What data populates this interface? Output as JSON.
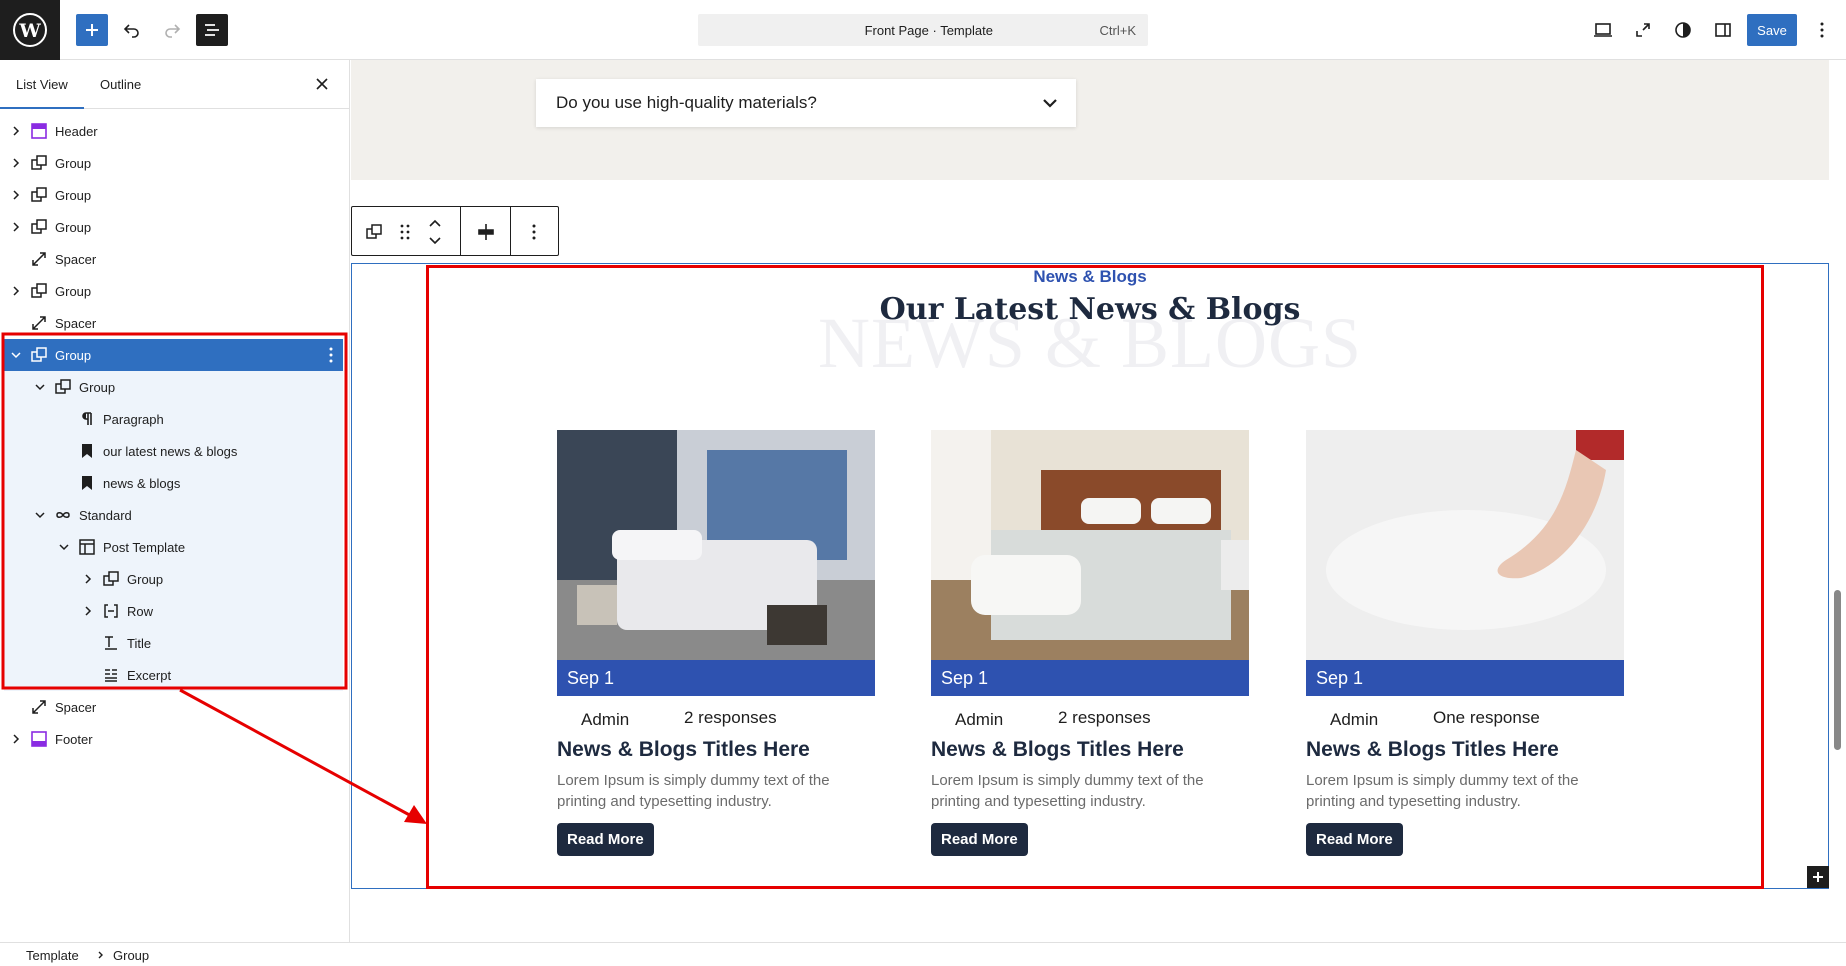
{
  "topbar": {
    "command_title": "Front Page · Template",
    "command_shortcut": "Ctrl+K",
    "save_label": "Save"
  },
  "panel": {
    "tabs": [
      "List View",
      "Outline"
    ],
    "tree": [
      {
        "label": "Header",
        "icon": "header-icon"
      },
      {
        "label": "Group",
        "icon": "group-icon"
      },
      {
        "label": "Group",
        "icon": "group-icon"
      },
      {
        "label": "Group",
        "icon": "group-icon"
      },
      {
        "label": "Spacer",
        "icon": "spacer-icon"
      },
      {
        "label": "Group",
        "icon": "group-icon"
      },
      {
        "label": "Spacer",
        "icon": "spacer-icon"
      },
      {
        "label": "Group",
        "icon": "group-icon",
        "selected": true
      },
      {
        "label": "Group",
        "icon": "group-icon"
      },
      {
        "label": "Paragraph",
        "icon": "paragraph-icon"
      },
      {
        "label": "our latest news & blogs",
        "icon": "bookmark-icon"
      },
      {
        "label": "news & blogs",
        "icon": "bookmark-icon"
      },
      {
        "label": "Standard",
        "icon": "loop-icon"
      },
      {
        "label": "Post Template",
        "icon": "layout-icon"
      },
      {
        "label": "Group",
        "icon": "group-icon"
      },
      {
        "label": "Row",
        "icon": "row-icon"
      },
      {
        "label": "Title",
        "icon": "title-icon"
      },
      {
        "label": "Excerpt",
        "icon": "excerpt-icon"
      },
      {
        "label": "Spacer",
        "icon": "spacer-icon"
      },
      {
        "label": "Footer",
        "icon": "footer-icon"
      }
    ]
  },
  "canvas": {
    "faq_question": "Do you use high-quality materials?",
    "eyebrow": "News & Blogs",
    "heading": "Our Latest News & Blogs",
    "ghost_text": "NEWS & BLOGS",
    "cards": [
      {
        "date": "Sep 1",
        "author": "Admin",
        "responses": "2 responses",
        "title": "News & Blogs Titles Here",
        "excerpt": "Lorem Ipsum is simply dummy text of the printing and typesetting industry.",
        "button": "Read More"
      },
      {
        "date": "Sep 1",
        "author": "Admin",
        "responses": "2 responses",
        "title": "News & Blogs Titles Here",
        "excerpt": "Lorem Ipsum is simply dummy text of the printing and typesetting industry.",
        "button": "Read More"
      },
      {
        "date": "Sep 1",
        "author": "Admin",
        "responses": "One response",
        "title": "News & Blogs Titles Here",
        "excerpt": "Lorem Ipsum is simply dummy text of the printing and typesetting industry.",
        "button": "Read More"
      }
    ]
  },
  "breadcrumb": [
    "Template",
    "Group"
  ],
  "colors": {
    "accent": "#2f6fc0",
    "brand_blue": "#2e52b0",
    "annotation_red": "#e60000",
    "dark_navy": "#1e2a3f"
  }
}
